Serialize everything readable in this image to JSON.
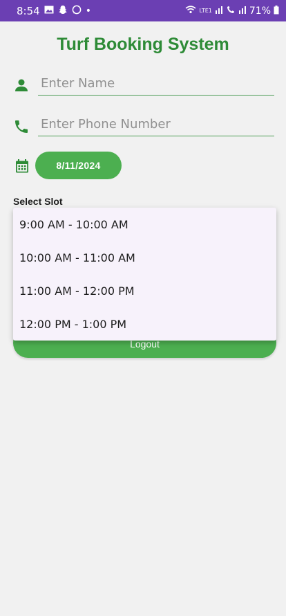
{
  "status_bar": {
    "time": "8:54",
    "notification_icons": [
      "image-icon",
      "snapchat-icon",
      "whatsapp-icon"
    ],
    "dot": "•",
    "signal_text": "LTE1",
    "battery": "71%"
  },
  "title": "Turf Booking System",
  "name_field": {
    "placeholder": "Enter Name",
    "icon": "person-icon"
  },
  "phone_field": {
    "placeholder": "Enter Phone Number",
    "icon": "phone-icon"
  },
  "date": {
    "value": "8/11/2024",
    "icon": "calendar-icon"
  },
  "slot": {
    "label": "Select Slot",
    "options": [
      "9:00 AM - 10:00 AM",
      "10:00 AM - 11:00 AM",
      "11:00 AM - 12:00 PM",
      "12:00 PM - 1:00 PM"
    ]
  },
  "logout_label": "Logout",
  "colors": {
    "status_bar": "#6b3fb3",
    "primary_green": "#4caf50",
    "title_green": "#2e8b37",
    "background": "#f1f1f1",
    "dropdown_bg": "#f7f2fb"
  }
}
